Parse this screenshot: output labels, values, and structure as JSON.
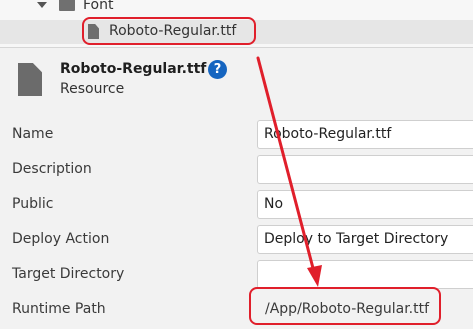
{
  "tree": {
    "folder_label": "Font",
    "file_label": "Roboto-Regular.ttf"
  },
  "header": {
    "title": "Roboto-Regular.ttf",
    "subtitle": "Resource",
    "help_glyph": "?"
  },
  "properties": [
    {
      "label": "Name",
      "value": "Roboto-Regular.ttf",
      "editable": true
    },
    {
      "label": "Description",
      "value": "",
      "editable": true
    },
    {
      "label": "Public",
      "value": "No",
      "editable": true
    },
    {
      "label": "Deploy Action",
      "value": "Deploy to Target Directory",
      "editable": true
    },
    {
      "label": "Target Directory",
      "value": "",
      "editable": true
    },
    {
      "label": "Runtime Path",
      "value": "/App/Roboto-Regular.ttf",
      "editable": false
    }
  ],
  "icons": {
    "folder": "folder-icon",
    "file": "file-icon",
    "help": "help-icon",
    "caret": "chevron-down-icon"
  },
  "colors": {
    "annotation": "#e01f2b",
    "help_accent": "#1565c0",
    "selected_row": "#e6e6e6"
  }
}
